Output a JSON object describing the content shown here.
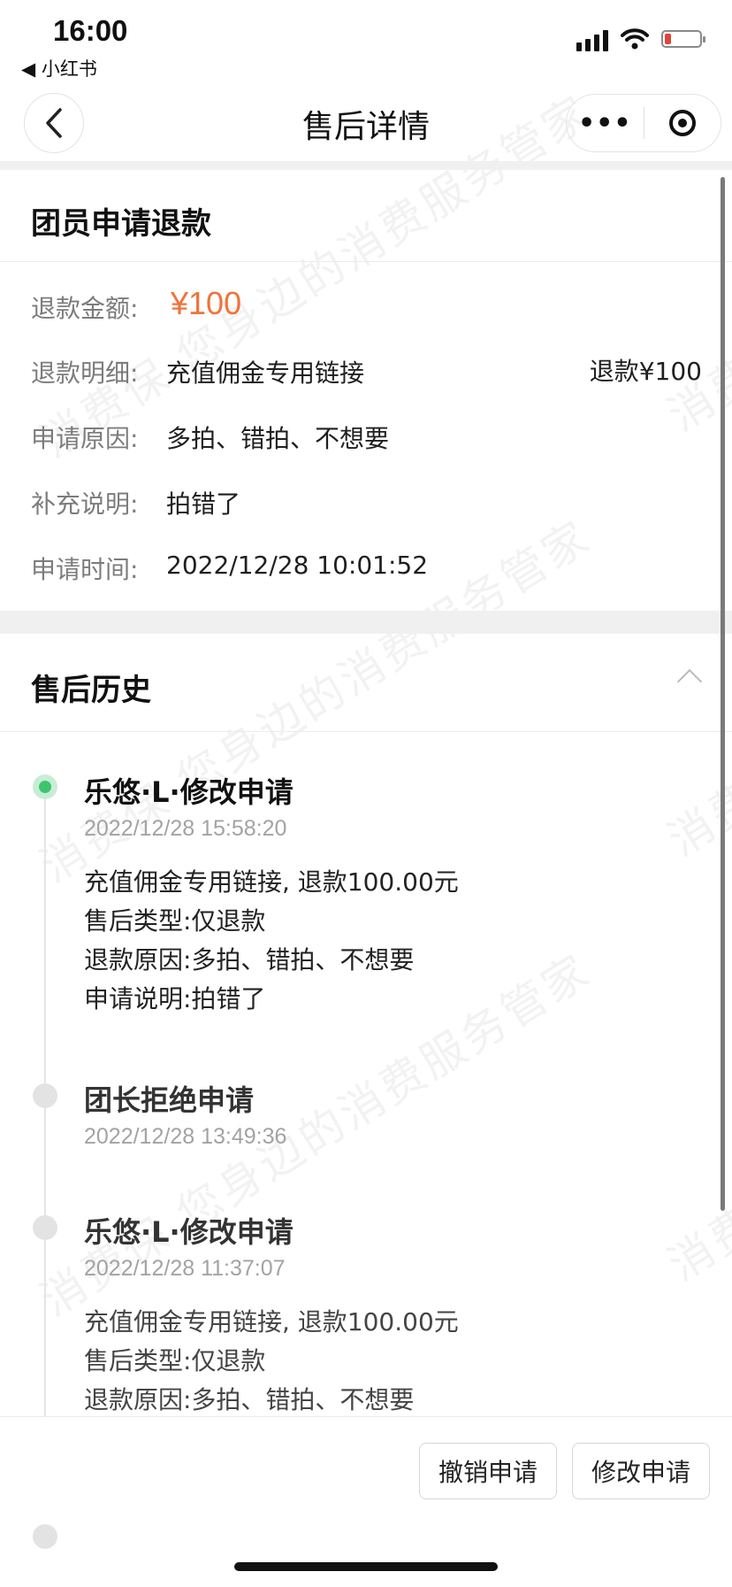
{
  "status_bar": {
    "time": "16:00",
    "back_app": "◀ 小红书"
  },
  "nav": {
    "title": "售后详情",
    "more_label": "•••"
  },
  "refund_section": {
    "title": "团员申请退款",
    "amount_label": "退款金额:",
    "amount_value": "¥100",
    "detail_label": "退款明细:",
    "detail_value": "充值佣金专用链接",
    "detail_refund": "退款¥100",
    "reason_label": "申请原因:",
    "reason_value": "多拍、错拍、不想要",
    "note_label": "补充说明:",
    "note_value": "拍错了",
    "time_label": "申请时间:",
    "time_value": "2022/12/28 10:01:52"
  },
  "history": {
    "title": "售后历史",
    "events": [
      {
        "title": "乐悠·L·修改申请",
        "time": "2022/12/28 15:58:20",
        "lines": [
          "充值佣金专用链接, 退款100.00元",
          "售后类型:仅退款",
          "退款原因:多拍、错拍、不想要",
          "申请说明:拍错了"
        ]
      },
      {
        "title": "团长拒绝申请",
        "time": "2022/12/28 13:49:36",
        "lines": []
      },
      {
        "title": "乐悠·L·修改申请",
        "time": "2022/12/28 11:37:07",
        "lines": [
          "充值佣金专用链接, 退款100.00元",
          "售后类型:仅退款",
          "退款原因:多拍、错拍、不想要"
        ]
      }
    ]
  },
  "actions": {
    "cancel_label": "撤销申请",
    "modify_label": "修改申请"
  },
  "watermark": "消费保 您身边的消费服务管家",
  "colors": {
    "accent_amount": "#f0733a",
    "active_dot": "#3ec46d"
  }
}
